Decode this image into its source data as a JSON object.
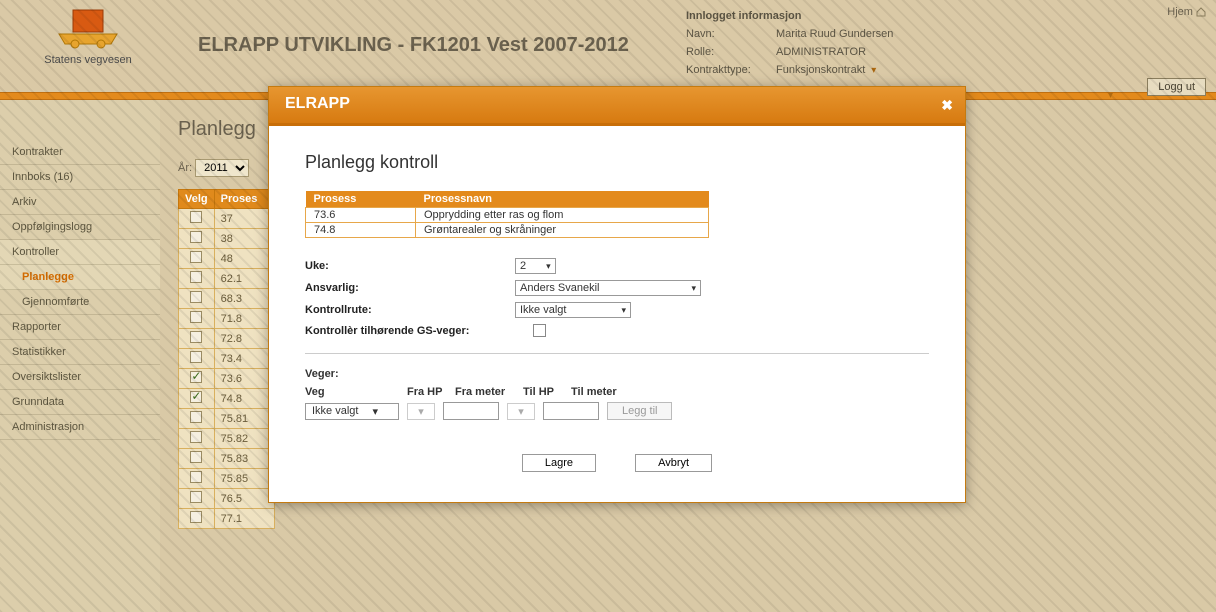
{
  "header": {
    "brand": "Statens vegvesen",
    "app_title": "ELRAPP UTVIKLING - FK1201 Vest 2007-2012",
    "home": "Hjem",
    "logout": "Logg ut"
  },
  "user_info": {
    "title": "Innlogget informasjon",
    "name_label": "Navn:",
    "name": "Marita Ruud Gundersen",
    "role_label": "Rolle:",
    "role": "ADMINISTRATOR",
    "contract_type_label": "Kontrakttype:",
    "contract_type": "Funksjonskontrakt"
  },
  "sidebar": {
    "items": [
      {
        "label": "Kontrakter"
      },
      {
        "label": "Innboks (16)"
      },
      {
        "label": "Arkiv"
      },
      {
        "label": "Oppfølgingslogg"
      },
      {
        "label": "Kontroller"
      },
      {
        "label": "Planlegge",
        "sub": true,
        "active": true
      },
      {
        "label": "Gjennomførte",
        "sub": true
      },
      {
        "label": "Rapporter"
      },
      {
        "label": "Statistikker"
      },
      {
        "label": "Oversiktslister"
      },
      {
        "label": "Grunndata"
      },
      {
        "label": "Administrasjon"
      }
    ]
  },
  "content": {
    "page_title": "Planlegg",
    "year_label": "År:",
    "year": "2011",
    "table": {
      "headers": [
        "Velg",
        "Proses"
      ],
      "rows": [
        {
          "checked": false,
          "code": "37"
        },
        {
          "checked": false,
          "code": "38"
        },
        {
          "checked": false,
          "code": "48"
        },
        {
          "checked": false,
          "code": "62.1"
        },
        {
          "checked": false,
          "code": "68.3"
        },
        {
          "checked": false,
          "code": "71.8"
        },
        {
          "checked": false,
          "code": "72.8"
        },
        {
          "checked": false,
          "code": "73.4"
        },
        {
          "checked": true,
          "code": "73.6"
        },
        {
          "checked": true,
          "code": "74.8"
        },
        {
          "checked": false,
          "code": "75.81"
        },
        {
          "checked": false,
          "code": "75.82"
        },
        {
          "checked": false,
          "code": "75.83"
        },
        {
          "checked": false,
          "code": "75.85"
        },
        {
          "checked": false,
          "code": "76.5"
        },
        {
          "checked": false,
          "code": "77.1"
        }
      ]
    }
  },
  "modal": {
    "title": "ELRAPP",
    "heading": "Planlegg kontroll",
    "proc_headers": {
      "code": "Prosess",
      "name": "Prosessnavn"
    },
    "procs": [
      {
        "code": "73.6",
        "name": "Opprydding etter ras og flom"
      },
      {
        "code": "74.8",
        "name": "Grøntarealer og skråninger"
      }
    ],
    "uke_label": "Uke:",
    "uke_value": "2",
    "ansvarlig_label": "Ansvarlig:",
    "ansvarlig_value": "Anders Svanekil",
    "rute_label": "Kontrollrute:",
    "rute_value": "Ikke valgt",
    "gs_label": "Kontrollèr tilhørende GS-veger:",
    "veger_label": "Veger:",
    "veg_headers": {
      "veg": "Veg",
      "frahp": "Fra HP",
      "frameter": "Fra meter",
      "tilhp": "Til HP",
      "tilmeter": "Til meter"
    },
    "veg_value": "Ikke valgt",
    "add_label": "Legg til",
    "save": "Lagre",
    "cancel": "Avbryt"
  }
}
